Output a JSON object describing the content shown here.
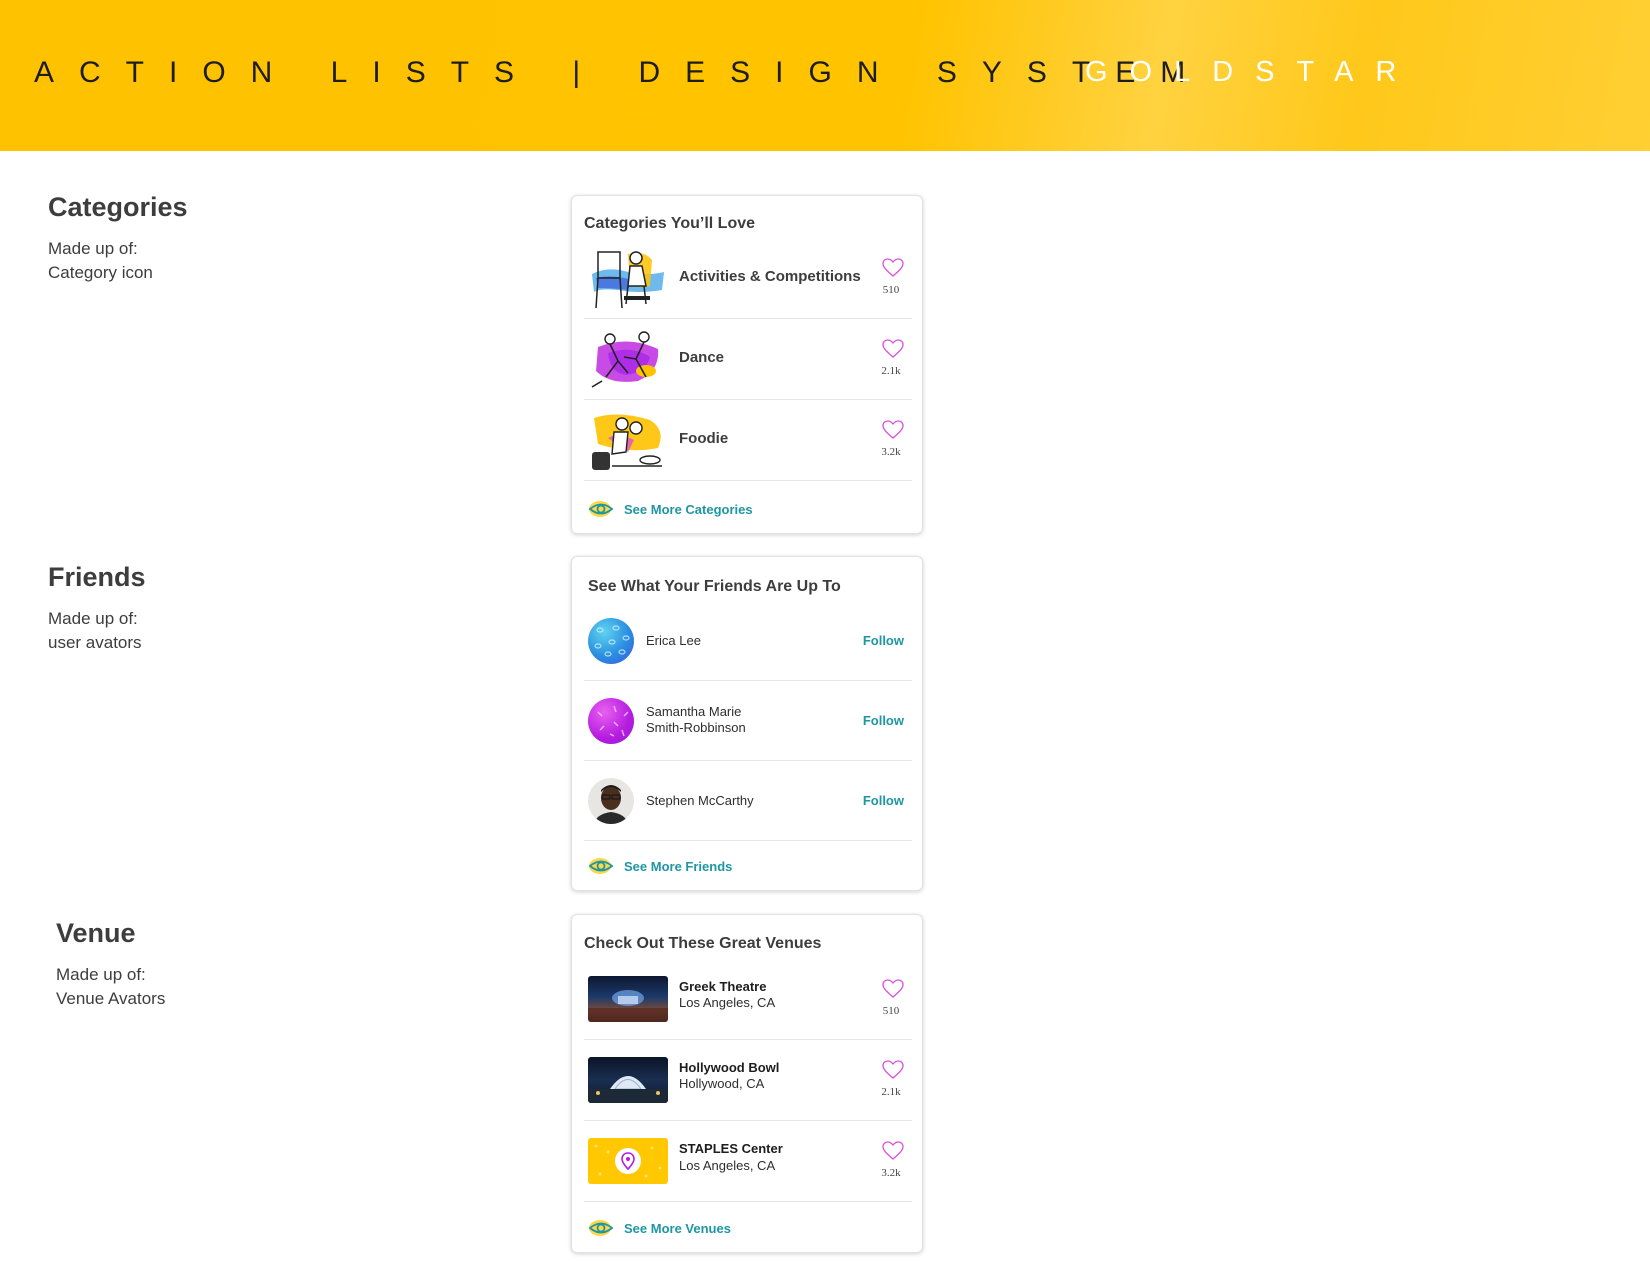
{
  "header": {
    "title": "ACTION LISTS | DESIGN SYSTEM",
    "brand": "GOLDSTAR"
  },
  "colors": {
    "banner": "#ffc200",
    "accent_teal": "#1e97a3",
    "heart_pink": "#d94fd8",
    "text_dark": "#3d3d3d"
  },
  "sections": {
    "categories": {
      "heading": "Categories",
      "made_up_of": "Made up of:",
      "detail": "Category icon"
    },
    "friends": {
      "heading": "Friends",
      "made_up_of": "Made up of:",
      "detail": "user avators"
    },
    "venue": {
      "heading": "Venue",
      "made_up_of": "Made up of:",
      "detail": "Venue Avators"
    }
  },
  "categories_card": {
    "title": "Categories You’ll Love",
    "items": [
      {
        "label": "Activities & Competitions",
        "count": "510",
        "icon": "painter-illustration-icon"
      },
      {
        "label": "Dance",
        "count": "2.1k",
        "icon": "dancers-illustration-icon"
      },
      {
        "label": "Foodie",
        "count": "3.2k",
        "icon": "diners-illustration-icon"
      }
    ],
    "see_more": "See More Categories"
  },
  "friends_card": {
    "title": "See What Your Friends Are Up To",
    "items": [
      {
        "name": "Erica Lee",
        "action": "Follow",
        "avatar": "blue-pattern-avatar"
      },
      {
        "name_line1": "Samantha Marie",
        "name_line2": "Smith-Robbinson",
        "action": "Follow",
        "avatar": "purple-pattern-avatar"
      },
      {
        "name": "Stephen McCarthy",
        "action": "Follow",
        "avatar": "photo-avatar"
      }
    ],
    "see_more": "See More Friends"
  },
  "venues_card": {
    "title": "Check Out These Great Venues",
    "items": [
      {
        "name": "Greek Theatre",
        "location": "Los Angeles, CA",
        "count": "510"
      },
      {
        "name": "Hollywood Bowl",
        "location": "Hollywood, CA",
        "count": "2.1k"
      },
      {
        "name": "STAPLES Center",
        "location": "Los Angeles, CA",
        "count": "3.2k"
      }
    ],
    "see_more": "See More Venues"
  }
}
